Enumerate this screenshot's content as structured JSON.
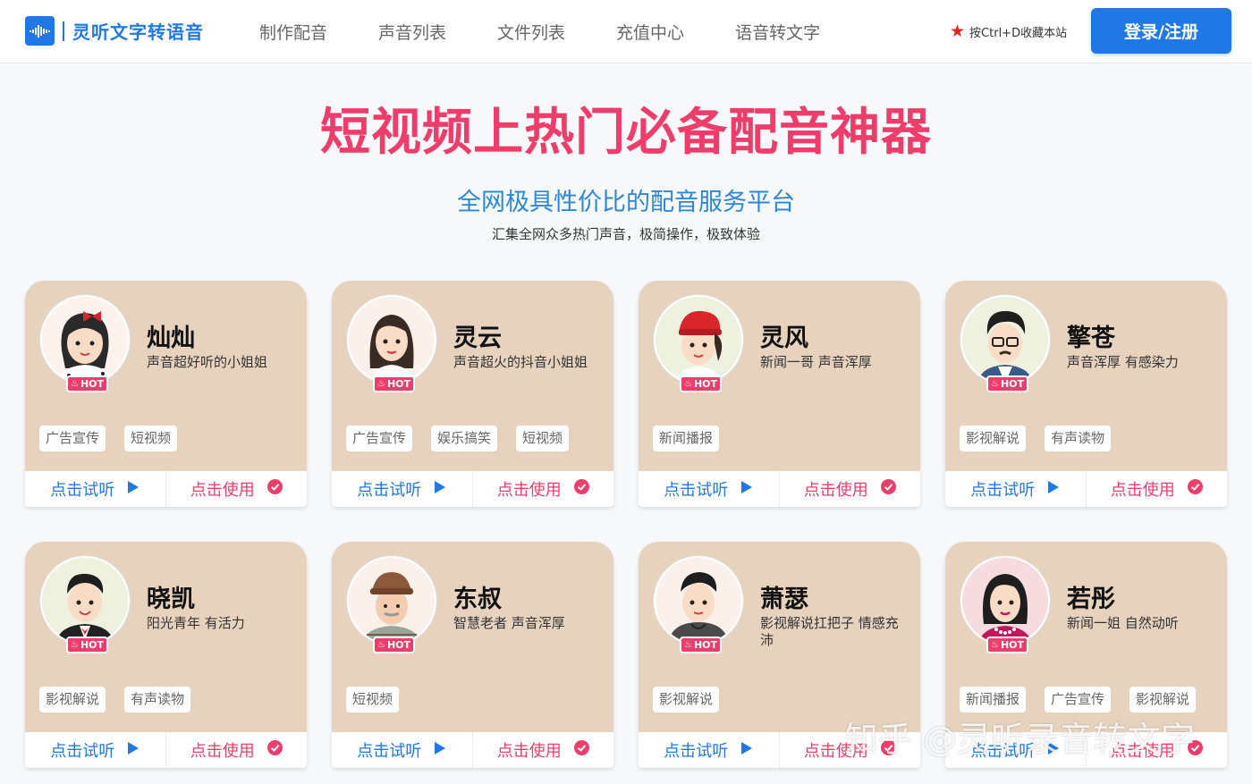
{
  "header": {
    "logo_text": "灵听文字转语音",
    "nav": [
      "制作配音",
      "声音列表",
      "文件列表",
      "充值中心",
      "语音转文字"
    ],
    "bookmark_hint": "按Ctrl+D收藏本站",
    "login_label": "登录/注册"
  },
  "hero": {
    "title": "短视频上热门必备配音神器",
    "subtitle": "全网极具性价比的配音服务平台",
    "description": "汇集全网众多热门声音，极简操作，极致体验"
  },
  "colors": {
    "brand_blue": "#1f78e6",
    "hot_pink": "#ee3d6b",
    "card_bg": "#e6d2bd"
  },
  "voices": [
    {
      "name": "灿灿",
      "desc": "声音超好听的小姐姐",
      "badge": "HOT",
      "tags": [
        "广告宣传",
        "短视频"
      ],
      "listen": "点击试听",
      "use": "点击使用",
      "avatar": "girl-bow-avatar"
    },
    {
      "name": "灵云",
      "desc": "声音超火的抖音小姐姐",
      "badge": "HOT",
      "tags": [
        "广告宣传",
        "娱乐搞笑",
        "短视频"
      ],
      "listen": "点击试听",
      "use": "点击使用",
      "avatar": "long-hair-girl-avatar"
    },
    {
      "name": "灵风",
      "desc": "新闻一哥 声音浑厚",
      "badge": "HOT",
      "tags": [
        "新闻播报"
      ],
      "listen": "点击试听",
      "use": "点击使用",
      "avatar": "red-cap-boy-avatar"
    },
    {
      "name": "擎苍",
      "desc": "声音浑厚 有感染力",
      "badge": "HOT",
      "tags": [
        "影视解说",
        "有声读物"
      ],
      "listen": "点击试听",
      "use": "点击使用",
      "avatar": "glasses-man-avatar"
    },
    {
      "name": "晓凯",
      "desc": "阳光青年 有活力",
      "badge": "HOT",
      "tags": [
        "影视解说",
        "有声读物"
      ],
      "listen": "点击试听",
      "use": "点击使用",
      "avatar": "suit-young-man-avatar"
    },
    {
      "name": "东叔",
      "desc": "智慧老者 声音浑厚",
      "badge": "HOT",
      "tags": [
        "短视频"
      ],
      "listen": "点击试听",
      "use": "点击使用",
      "avatar": "old-man-hat-avatar"
    },
    {
      "name": "萧瑟",
      "desc": "影视解说扛把子 情感充沛",
      "badge": "HOT",
      "tags": [
        "影视解说"
      ],
      "listen": "点击试听",
      "use": "点击使用",
      "avatar": "hoodie-man-avatar"
    },
    {
      "name": "若彤",
      "desc": "新闻一姐 自然动听",
      "badge": "HOT",
      "tags": [
        "新闻播报",
        "广告宣传",
        "影视解说"
      ],
      "listen": "点击试听",
      "use": "点击使用",
      "avatar": "pearl-woman-avatar"
    }
  ],
  "watermark": "知乎 @灵听录音转文字"
}
